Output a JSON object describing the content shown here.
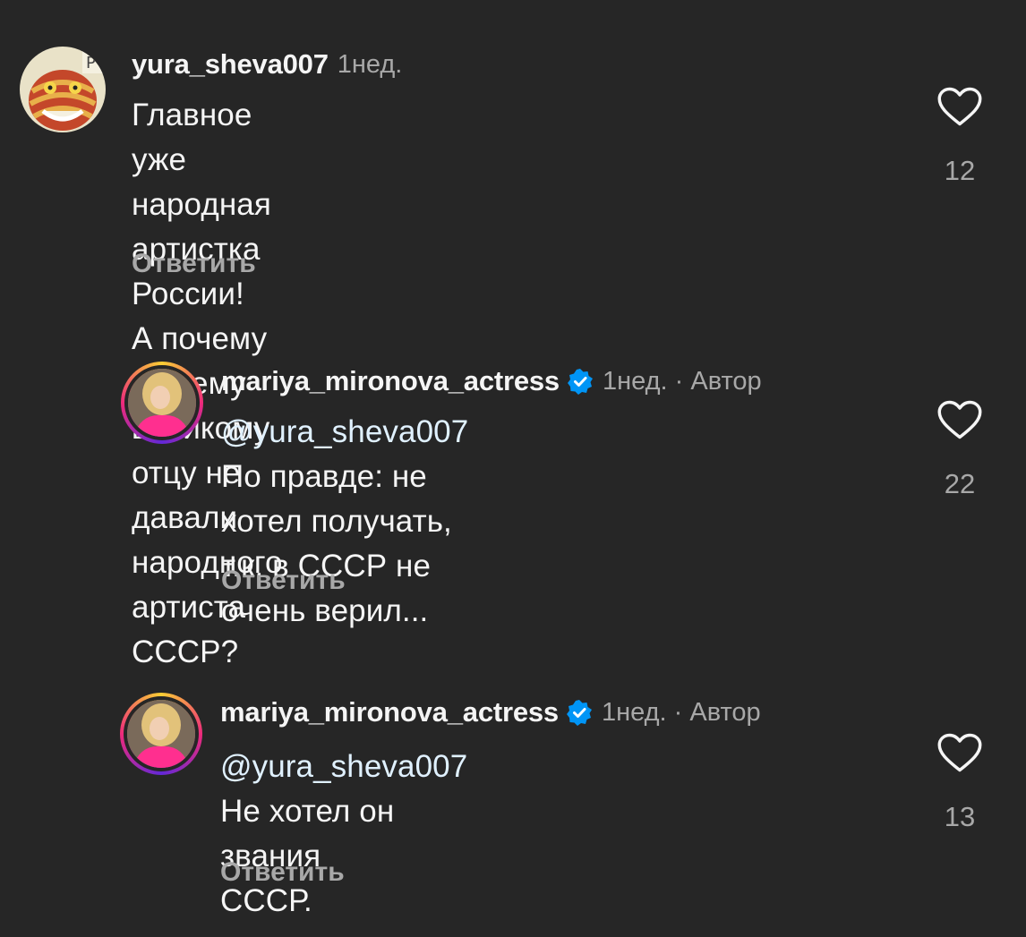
{
  "comments": [
    {
      "username": "yura_sheva007",
      "time": "1нед.",
      "author_tag": "",
      "mention": "",
      "text_lines": [
        "Главное уже народная артистка России!",
        "А почему вашему великому отцу не",
        "давали народного артиста СССР?"
      ],
      "reply_label": "Ответить",
      "likes": "12",
      "avatar_icon": "cheshire-cat-avatar"
    },
    {
      "username": "mariya_mironova_actress",
      "time": "1нед. · Автор",
      "mention": "@yura_sheva007",
      "text_lines": [
        " По правде: не",
        "хотел получать, т.к. в СССР не",
        "очень верил..."
      ],
      "reply_label": "Ответить",
      "likes": "22",
      "avatar_icon": "actress-avatar"
    },
    {
      "username": "mariya_mironova_actress",
      "time": "1нед. · Автор",
      "mention": "@yura_sheva007",
      "text_lines": [
        " Не хотел он звания",
        "СССР."
      ],
      "reply_label": "Ответить",
      "likes": "13",
      "avatar_icon": "actress-avatar"
    }
  ],
  "colors": {
    "background": "#262626",
    "text": "#f5f5f5",
    "muted": "#a8a8a8",
    "mention": "#e0f1ff",
    "verified": "#0095f6"
  }
}
